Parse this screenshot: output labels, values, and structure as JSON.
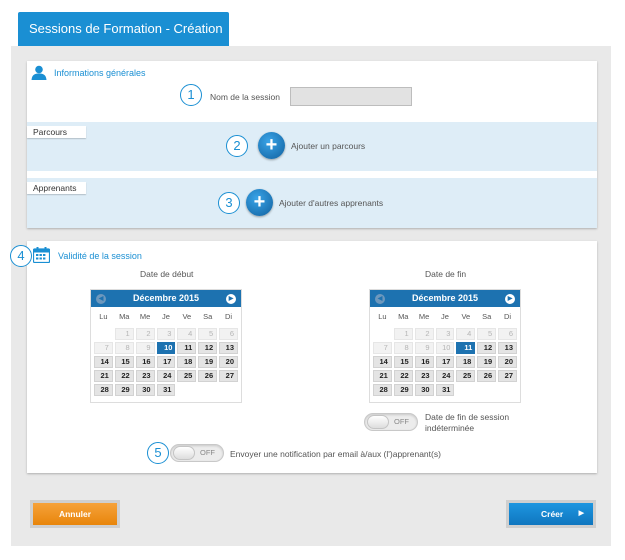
{
  "header": {
    "title": "Sessions de Formation - Création"
  },
  "general": {
    "title": "Informations générales",
    "session_name_label": "Nom de la session",
    "session_name_value": "",
    "step1": "1"
  },
  "parcours": {
    "label": "Parcours",
    "add_label": "Ajouter un parcours",
    "step": "2"
  },
  "apprenants": {
    "label": "Apprenants",
    "add_label": "Ajouter d'autres apprenants",
    "step": "3"
  },
  "validity": {
    "title": "Validité de la session",
    "step": "4",
    "start": {
      "label": "Date de début",
      "month": "Décembre 2015",
      "weekdays": [
        "Lu",
        "Ma",
        "Me",
        "Je",
        "Ve",
        "Sa",
        "Di"
      ],
      "days": [
        {
          "d": "",
          "t": "blank"
        },
        {
          "d": "1",
          "t": "prev"
        },
        {
          "d": "2",
          "t": "prev"
        },
        {
          "d": "3",
          "t": "prev"
        },
        {
          "d": "4",
          "t": "prev"
        },
        {
          "d": "5",
          "t": "prev"
        },
        {
          "d": "6",
          "t": "prev"
        },
        {
          "d": "7",
          "t": "prev"
        },
        {
          "d": "8",
          "t": "prev"
        },
        {
          "d": "9",
          "t": "prev"
        },
        {
          "d": "10",
          "t": "today"
        },
        {
          "d": "11",
          "t": "next"
        },
        {
          "d": "12",
          "t": "next"
        },
        {
          "d": "13",
          "t": "next"
        },
        {
          "d": "14",
          "t": "next"
        },
        {
          "d": "15",
          "t": "next"
        },
        {
          "d": "16",
          "t": "next"
        },
        {
          "d": "17",
          "t": "next"
        },
        {
          "d": "18",
          "t": "next"
        },
        {
          "d": "19",
          "t": "next"
        },
        {
          "d": "20",
          "t": "next"
        },
        {
          "d": "21",
          "t": "next"
        },
        {
          "d": "22",
          "t": "next"
        },
        {
          "d": "23",
          "t": "next"
        },
        {
          "d": "24",
          "t": "next"
        },
        {
          "d": "25",
          "t": "next"
        },
        {
          "d": "26",
          "t": "next"
        },
        {
          "d": "27",
          "t": "next"
        },
        {
          "d": "28",
          "t": "next"
        },
        {
          "d": "29",
          "t": "next"
        },
        {
          "d": "30",
          "t": "next"
        },
        {
          "d": "31",
          "t": "next"
        }
      ]
    },
    "end": {
      "label": "Date de fin",
      "month": "Décembre 2015",
      "weekdays": [
        "Lu",
        "Ma",
        "Me",
        "Je",
        "Ve",
        "Sa",
        "Di"
      ],
      "days": [
        {
          "d": "",
          "t": "blank"
        },
        {
          "d": "1",
          "t": "prev"
        },
        {
          "d": "2",
          "t": "prev"
        },
        {
          "d": "3",
          "t": "prev"
        },
        {
          "d": "4",
          "t": "prev"
        },
        {
          "d": "5",
          "t": "prev"
        },
        {
          "d": "6",
          "t": "prev"
        },
        {
          "d": "7",
          "t": "prev"
        },
        {
          "d": "8",
          "t": "prev"
        },
        {
          "d": "9",
          "t": "prev"
        },
        {
          "d": "10",
          "t": "prev"
        },
        {
          "d": "11",
          "t": "today"
        },
        {
          "d": "12",
          "t": "next"
        },
        {
          "d": "13",
          "t": "next"
        },
        {
          "d": "14",
          "t": "next"
        },
        {
          "d": "15",
          "t": "next"
        },
        {
          "d": "16",
          "t": "next"
        },
        {
          "d": "17",
          "t": "next"
        },
        {
          "d": "18",
          "t": "next"
        },
        {
          "d": "19",
          "t": "next"
        },
        {
          "d": "20",
          "t": "next"
        },
        {
          "d": "21",
          "t": "next"
        },
        {
          "d": "22",
          "t": "next"
        },
        {
          "d": "23",
          "t": "next"
        },
        {
          "d": "24",
          "t": "next"
        },
        {
          "d": "25",
          "t": "next"
        },
        {
          "d": "26",
          "t": "next"
        },
        {
          "d": "27",
          "t": "next"
        },
        {
          "d": "28",
          "t": "next"
        },
        {
          "d": "29",
          "t": "next"
        },
        {
          "d": "30",
          "t": "next"
        },
        {
          "d": "31",
          "t": "next"
        }
      ]
    },
    "indefinite_toggle": "OFF",
    "indefinite_label_1": "Date de fin de session",
    "indefinite_label_2": "indéterminée"
  },
  "notification": {
    "step": "5",
    "toggle": "OFF",
    "label": "Envoyer une notification par email à/aux (l')apprenant(s)"
  },
  "actions": {
    "cancel_label": "Annuler",
    "create_label": "Créer"
  },
  "colors": {
    "accent": "#1a8fd3",
    "cancel": "#f08c14",
    "create": "#1683cf"
  }
}
